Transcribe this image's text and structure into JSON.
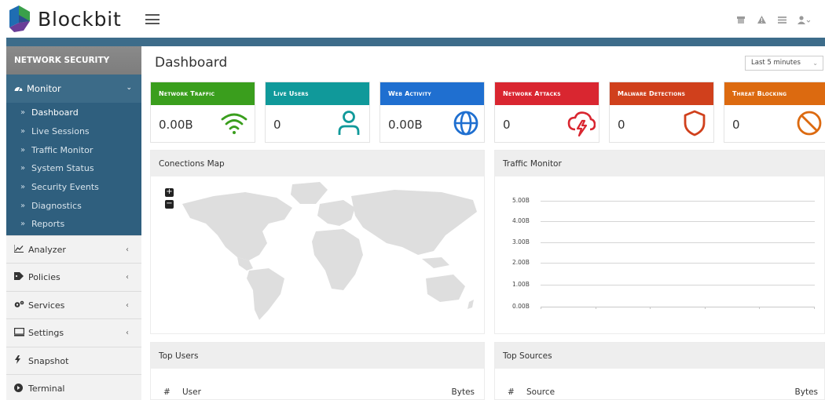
{
  "brand": {
    "name": "Blockbit"
  },
  "header": {
    "icons": [
      "archive-icon",
      "warning-icon",
      "list-icon",
      "user-icon"
    ]
  },
  "sidebar": {
    "section_title": "NETWORK SECURITY",
    "monitor": {
      "label": "Monitor",
      "items": [
        "Dashboard",
        "Live Sessions",
        "Traffic Monitor",
        "System Status",
        "Security Events",
        "Diagnostics",
        "Reports"
      ],
      "active": "Dashboard"
    },
    "items": [
      {
        "label": "Analyzer",
        "icon": "chart-line-icon",
        "has_submenu": true
      },
      {
        "label": "Policies",
        "icon": "tag-icon",
        "has_submenu": true
      },
      {
        "label": "Services",
        "icon": "cogs-icon",
        "has_submenu": true
      },
      {
        "label": "Settings",
        "icon": "monitor-icon",
        "has_submenu": true
      },
      {
        "label": "Snapshot",
        "icon": "bolt-icon",
        "has_submenu": false
      },
      {
        "label": "Terminal",
        "icon": "terminal-icon",
        "has_submenu": false
      }
    ]
  },
  "main": {
    "title": "Dashboard",
    "time_range": "Last 5 minutes",
    "cards": [
      {
        "title": "Network Traffic",
        "value": "0.00B",
        "color": "#3a9e1d",
        "icon": "wifi-icon"
      },
      {
        "title": "Live Users",
        "value": "0",
        "color": "#10999a",
        "icon": "user-outline-icon"
      },
      {
        "title": "Web Activity",
        "value": "0.00B",
        "color": "#1f6fd0",
        "icon": "globe-icon"
      },
      {
        "title": "Network Attacks",
        "value": "0",
        "color": "#d92630",
        "icon": "storm-icon"
      },
      {
        "title": "Malware Detections",
        "value": "0",
        "color": "#d0401c",
        "icon": "shield-icon"
      },
      {
        "title": "Threat Blocking",
        "value": "0",
        "color": "#dc6a10",
        "icon": "block-icon"
      }
    ],
    "connections_map": {
      "title": "Conections Map",
      "zoom_in": "+",
      "zoom_out": "−"
    },
    "traffic_monitor": {
      "title": "Traffic Monitor",
      "y_labels": [
        "5.00B",
        "4.00B",
        "3.00B",
        "2.00B",
        "1.00B",
        "0.00B"
      ]
    },
    "top_users": {
      "title": "Top Users",
      "columns": [
        "#",
        "User",
        "Bytes"
      ]
    },
    "top_sources": {
      "title": "Top Sources",
      "columns": [
        "#",
        "Source",
        "Bytes"
      ]
    }
  }
}
